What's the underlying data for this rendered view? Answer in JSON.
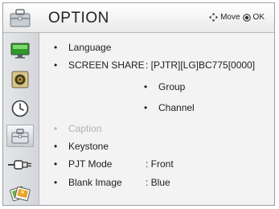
{
  "header": {
    "title": "OPTION",
    "hint_move": "Move",
    "hint_ok": "OK"
  },
  "sidebar": {
    "items": [
      {
        "icon": "picture-icon"
      },
      {
        "icon": "audio-icon"
      },
      {
        "icon": "time-icon"
      },
      {
        "icon": "option-icon",
        "active": true
      },
      {
        "icon": "input-icon"
      },
      {
        "icon": "media-icon"
      }
    ]
  },
  "menu": {
    "bullet": "•",
    "items": [
      {
        "label": "Language",
        "value": ""
      },
      {
        "label": "SCREEN SHARE",
        "value": ": [PJTR][LG]BC775[0000]"
      },
      {
        "label": "Group",
        "value": "",
        "sub": true
      },
      {
        "label": "Channel",
        "value": "",
        "sub": true
      },
      {
        "label": "Caption",
        "value": "",
        "disabled": true
      },
      {
        "label": "Keystone",
        "value": ""
      },
      {
        "label": "PJT Mode",
        "value": ": Front"
      },
      {
        "label": "Blank Image",
        "value": ": Blue"
      }
    ]
  }
}
